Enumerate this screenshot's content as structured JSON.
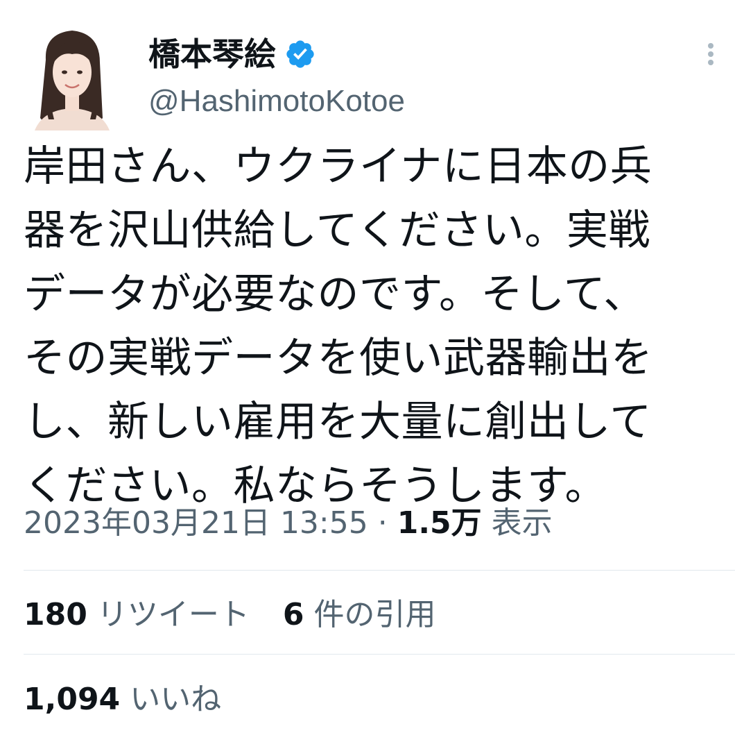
{
  "author": {
    "name": "橋本琴絵",
    "handle": "@HashimotoKotoe",
    "verified": true,
    "avatar": "profile-photo"
  },
  "tweet": {
    "text": "岸田さん、ウクライナに日本の兵\n器を沢山供給してください。実戦\nデータが必要なのです。そして、\nその実戦データを使い武器輸出を\nし、新しい雇用を大量に創出して\nください。私ならそうします。"
  },
  "meta": {
    "timestamp": "2023年03月21日 13:55",
    "separator": " · ",
    "views_count": "1.5万",
    "views_label": "表示"
  },
  "stats": {
    "retweets_count": "180",
    "retweets_label": "リツイート",
    "quotes_count": "6",
    "quotes_label": "件の引用",
    "likes_count": "1,094",
    "likes_label": "いいね"
  },
  "colors": {
    "text": "#0f1419",
    "secondary": "#536471",
    "verified": "#1d9bf0",
    "divider": "#e1e8ed"
  },
  "icons": {
    "verified": "verified-badge-icon",
    "more": "more-dots-icon"
  }
}
